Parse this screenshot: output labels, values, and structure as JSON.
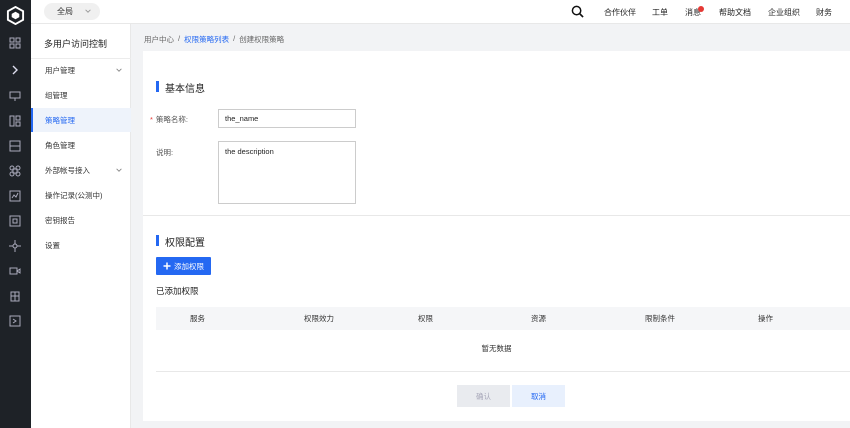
{
  "header": {
    "scope": "全局",
    "nav": [
      "合作伙伴",
      "工单",
      "消息",
      "帮助文档",
      "企业组织",
      "财务"
    ]
  },
  "sidebar": {
    "title": "多用户访问控制",
    "items": [
      {
        "label": "用户管理"
      },
      {
        "label": "组管理"
      },
      {
        "label": "策略管理"
      },
      {
        "label": "角色管理"
      },
      {
        "label": "外部帐号接入"
      },
      {
        "label": "操作记录(公测中)"
      },
      {
        "label": "密钥报告"
      },
      {
        "label": "设置"
      }
    ]
  },
  "breadcrumb": {
    "root": "用户中心",
    "sep": "/",
    "list": "权限策略列表",
    "current": "创建权限策略"
  },
  "basic": {
    "title": "基本信息",
    "name_required": "*",
    "name_label": "策略名称:",
    "name_value": "the_name",
    "desc_label": "说明:",
    "desc_value": "the description"
  },
  "perm": {
    "title": "权限配置",
    "add_button": "添加权限",
    "added_title": "已添加权限",
    "columns": [
      "服务",
      "权限效力",
      "权限",
      "资源",
      "限制条件",
      "操作"
    ],
    "empty": "暂无数据"
  },
  "footer": {
    "confirm": "确认",
    "cancel": "取消"
  },
  "colors": {
    "accent": "#2468f2",
    "rail": "#1e2227",
    "badge": "#e53935"
  }
}
